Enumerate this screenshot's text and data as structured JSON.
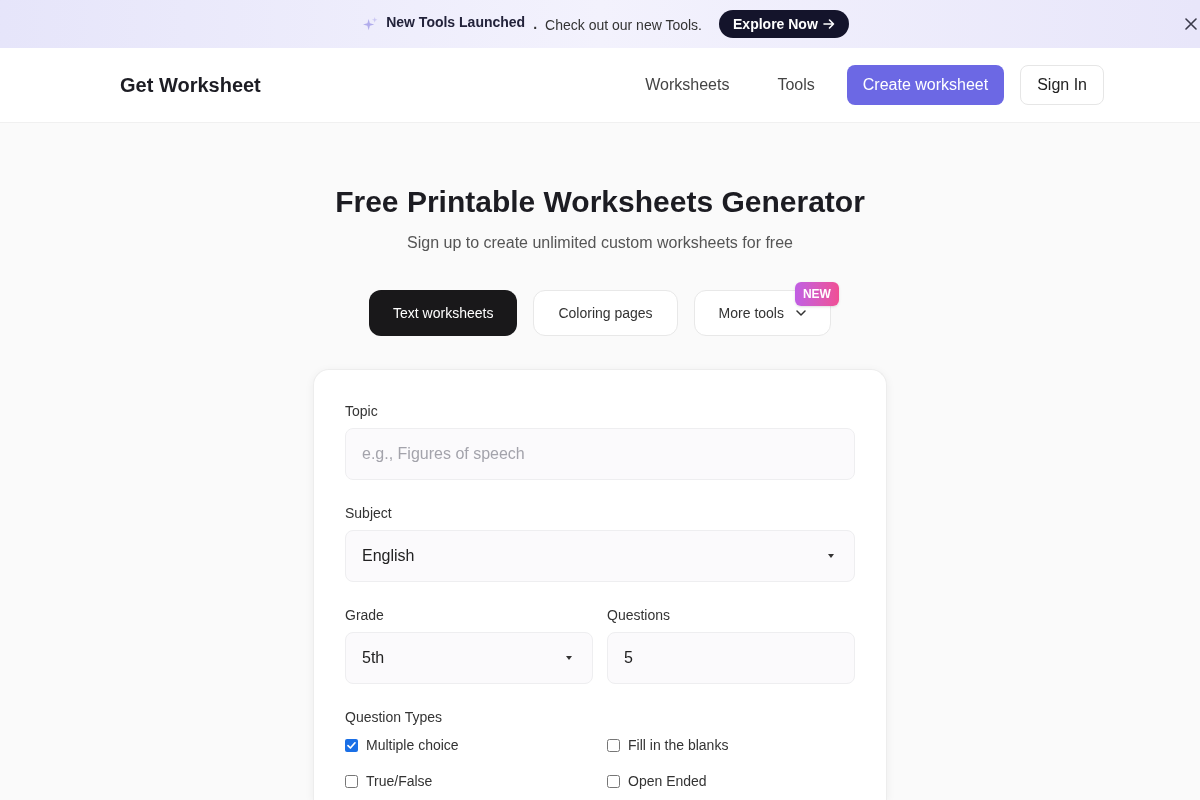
{
  "banner": {
    "headline": "New Tools Launched",
    "separator": ".",
    "message": "Check out our new Tools.",
    "button": "Explore Now"
  },
  "nav": {
    "logo": "Get Worksheet",
    "links": [
      "Worksheets",
      "Tools"
    ],
    "buttons": [
      {
        "label": "Create worksheet",
        "kind": "primary"
      },
      {
        "label": "Sign In",
        "kind": "outline"
      }
    ]
  },
  "hero": {
    "title": "Free Printable Worksheets Generator",
    "subtitle": "Sign up to create unlimited custom worksheets for free"
  },
  "tabs": [
    {
      "label": "Text worksheets",
      "selected": true,
      "kind": "tab"
    },
    {
      "label": "Coloring pages",
      "selected": false,
      "kind": "tab"
    },
    {
      "label": "More tools",
      "selected": false,
      "kind": "menu",
      "badge": "NEW"
    }
  ],
  "form": {
    "field_rows": [
      [
        {
          "label": "Topic",
          "kind": "text",
          "placeholder": "e.g., Figures of speech"
        }
      ],
      [
        {
          "label": "Subject",
          "kind": "select",
          "value": "English"
        }
      ],
      [
        {
          "label": "Grade",
          "kind": "select",
          "value": "5th"
        },
        {
          "label": "Questions",
          "kind": "text",
          "value": "5"
        }
      ]
    ],
    "question_types": {
      "label": "Question Types",
      "options": [
        {
          "label": "Multiple choice",
          "checked": true
        },
        {
          "label": "Fill in the blanks",
          "checked": false
        },
        {
          "label": "True/False",
          "checked": false
        },
        {
          "label": "Open Ended",
          "checked": false
        }
      ]
    }
  }
}
